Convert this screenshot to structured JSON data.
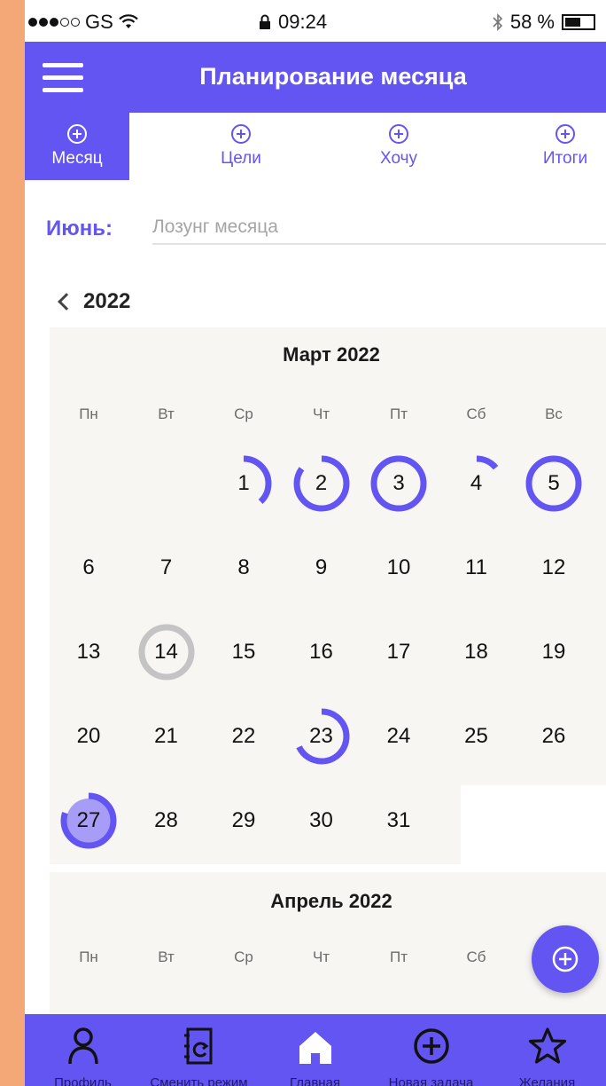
{
  "status_bar": {
    "carrier": "GS",
    "time": "09:24",
    "battery": "58 %",
    "battery_level": 0.58
  },
  "header": {
    "title": "Планирование месяца"
  },
  "tabs": [
    {
      "label": "Месяц",
      "active": true
    },
    {
      "label": "Цели",
      "active": false
    },
    {
      "label": "Хочу",
      "active": false
    },
    {
      "label": "Итоги",
      "active": false
    }
  ],
  "slogan": {
    "label": "Июнь:",
    "placeholder": "Лозунг месяца",
    "value": ""
  },
  "year_nav": {
    "year": "2022"
  },
  "weekdays": [
    "Пн",
    "Вт",
    "Ср",
    "Чт",
    "Пт",
    "Сб",
    "Вс"
  ],
  "calendar": {
    "march": {
      "title": "Март 2022",
      "days": [
        "1",
        "2",
        "3",
        "4",
        "5",
        "6",
        "7",
        "8",
        "9",
        "10",
        "11",
        "12",
        "13",
        "14",
        "15",
        "16",
        "17",
        "18",
        "19",
        "20",
        "21",
        "22",
        "23",
        "24",
        "25",
        "26",
        "27",
        "28",
        "29",
        "30",
        "31"
      ],
      "progress": {
        "1": 0.38,
        "2": 0.85,
        "3": 1.0,
        "4": 0.14,
        "5": 1.0,
        "14": 1.0,
        "23": 0.68,
        "27": 0.8
      }
    },
    "april": {
      "title": "Апрель 2022"
    }
  },
  "colors": {
    "accent": "#6355F2",
    "background": "#F5A877",
    "calendar_bg": "#F8F6F2",
    "today_ring": "#C4C4C4"
  },
  "bottom_nav": [
    {
      "label": "Профиль",
      "icon": "person-icon"
    },
    {
      "label": "Сменить режим",
      "icon": "switch-mode-icon"
    },
    {
      "label": "Главная",
      "icon": "home-icon"
    },
    {
      "label": "Новая задача",
      "icon": "plus-circle-icon"
    },
    {
      "label": "Желания",
      "icon": "star-icon"
    }
  ]
}
